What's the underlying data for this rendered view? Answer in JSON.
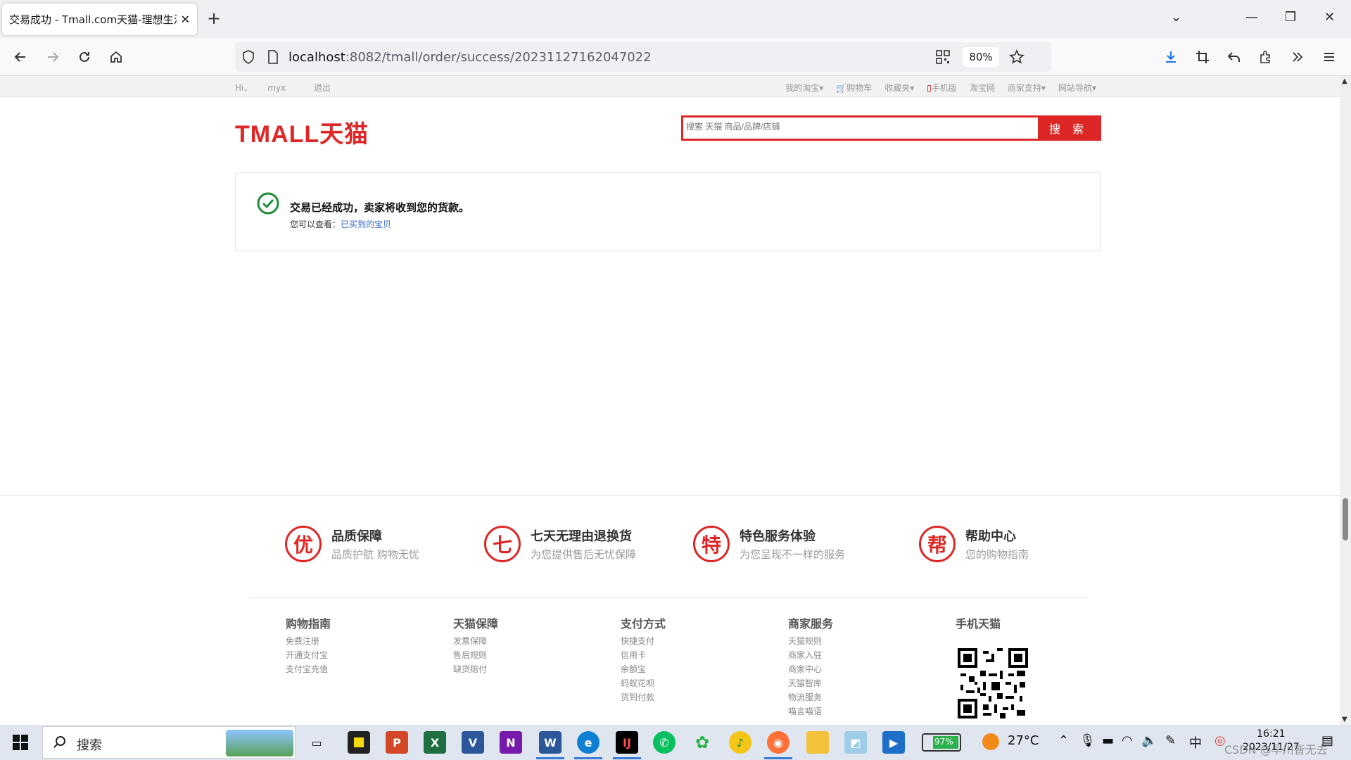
{
  "browser": {
    "tab_title": "交易成功 - Tmall.com天猫-理想生活上天猫",
    "url_host": "localhost",
    "url_path": ":8082/tmall/order/success/20231127162047022",
    "zoom": "80%"
  },
  "site": {
    "greeting": "Hi，",
    "username": "myx",
    "logout": "退出",
    "nav": [
      "我的淘宝",
      "购物车",
      "收藏夹",
      "手机版",
      "淘宝网",
      "商家支持",
      "网站导航"
    ],
    "logo_text": "TMALL天猫",
    "search_placeholder": "搜索 天猫 商品/品牌/店铺",
    "search_button": "搜 索"
  },
  "success": {
    "title": "交易已经成功，卖家将收到您的货款。",
    "sub_label": "您可以查看：",
    "sub_link": "已买到的宝贝"
  },
  "guarantees": [
    {
      "icon": "优",
      "title": "品质保障",
      "sub": "品质护航 购物无忧"
    },
    {
      "icon": "七",
      "title": "七天无理由退换货",
      "sub": "为您提供售后无忧保障"
    },
    {
      "icon": "特",
      "title": "特色服务体验",
      "sub": "为您呈现不一样的服务"
    },
    {
      "icon": "帮",
      "title": "帮助中心",
      "sub": "您的购物指南"
    }
  ],
  "footer_columns": [
    {
      "title": "购物指南",
      "items": [
        "免费注册",
        "开通支付宝",
        "支付宝充值"
      ]
    },
    {
      "title": "天猫保障",
      "items": [
        "发票保障",
        "售后规则",
        "缺货赔付"
      ]
    },
    {
      "title": "支付方式",
      "items": [
        "快捷支付",
        "信用卡",
        "余额宝",
        "蚂蚁花呗",
        "货到付款"
      ]
    },
    {
      "title": "商家服务",
      "items": [
        "天猫规则",
        "商家入驻",
        "商家中心",
        "天猫智库",
        "物流服务",
        "喵言喵语"
      ]
    },
    {
      "title": "手机天猫",
      "items": []
    }
  ],
  "taskbar": {
    "search_label": "搜索",
    "battery": "97%",
    "temperature": "27°C",
    "ime": "中",
    "time": "16:21",
    "date": "2023/11/27",
    "watermark": "CSDN @早川皆无去"
  },
  "colors": {
    "brand_red": "#dd2727",
    "link_blue": "#3366cc",
    "success_green": "#1f8b3a"
  }
}
